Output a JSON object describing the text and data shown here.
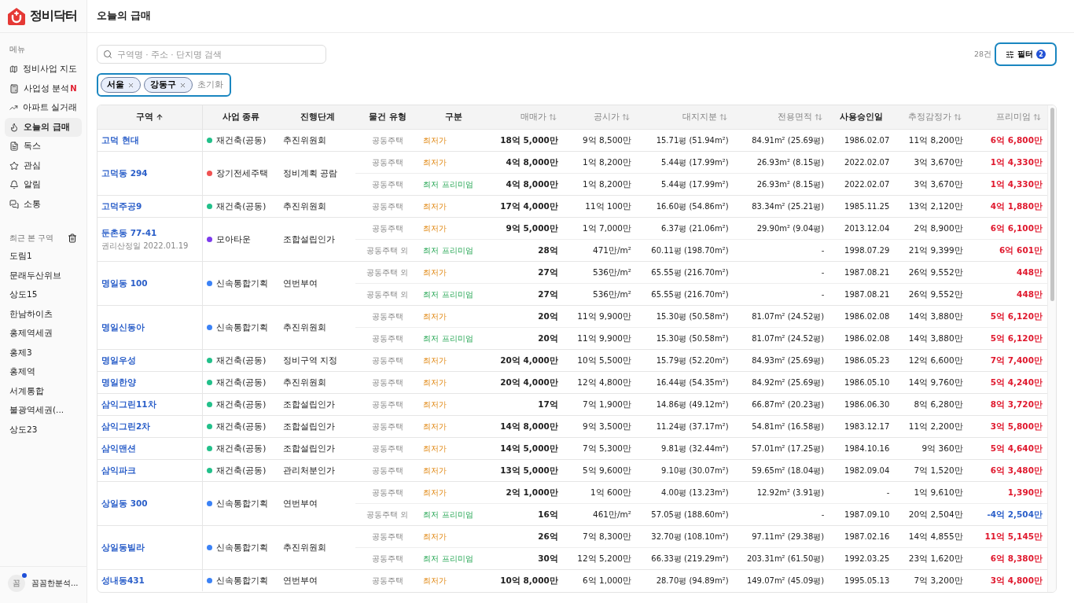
{
  "sidebar": {
    "logo": "정비닥터",
    "menu_label": "메뉴",
    "menu": [
      {
        "label": "정비사업 지도",
        "selected": false
      },
      {
        "label": "사업성 분석",
        "selected": false,
        "badge": "N"
      },
      {
        "label": "아파트 실거래",
        "selected": false
      },
      {
        "label": "오늘의 급매",
        "selected": true
      },
      {
        "label": "독스",
        "selected": false
      },
      {
        "label": "관심",
        "selected": false
      },
      {
        "label": "알림",
        "selected": false
      },
      {
        "label": "소통",
        "selected": false
      }
    ],
    "recent_label": "최근 본 구역",
    "recent": [
      "도림1",
      "문래두산위브",
      "상도15",
      "한남하이츠",
      "홍제역세권",
      "홍제3",
      "홍제역",
      "서계통합",
      "불광역세권(...",
      "상도23"
    ],
    "user": {
      "avatar": "꼼",
      "name": "꼼꼼한분석...",
      "online": true
    }
  },
  "page_title": "오늘의 급매",
  "search": {
    "placeholder": "구역명 · 주소 · 단지명 검색"
  },
  "result_count": "28건",
  "filter": {
    "label": "필터",
    "count": "2"
  },
  "chips": [
    "서울",
    "강동구"
  ],
  "reset": "초기화",
  "table": {
    "columns": [
      {
        "label": "구역",
        "sortable": true,
        "sorted": true
      },
      {
        "label": "사업 종류",
        "sortable": false,
        "sorted": false
      },
      {
        "label": "진행단계",
        "sortable": false,
        "sorted": false
      },
      {
        "label": "물건 유형",
        "sortable": false,
        "sorted": false
      },
      {
        "label": "구분",
        "sortable": false,
        "sorted": false
      },
      {
        "label": "매매가",
        "sortable": true,
        "sorted": false
      },
      {
        "label": "공시가",
        "sortable": true,
        "sorted": false
      },
      {
        "label": "대지지분",
        "sortable": true,
        "sorted": false
      },
      {
        "label": "전용면적",
        "sortable": true,
        "sorted": false
      },
      {
        "label": "사용승인일",
        "sortable": false,
        "sorted": false
      },
      {
        "label": "추정감정가",
        "sortable": true,
        "sorted": false
      },
      {
        "label": "프리미엄",
        "sortable": true,
        "sorted": false
      }
    ],
    "groups": [
      {
        "name": "고덕 현대",
        "type": {
          "label": "재건축(공동)",
          "color": "#22c08a"
        },
        "stage": "추진위원회",
        "listings": [
          {
            "property_type": "공동주택",
            "kind": "lowest",
            "category": "최저가",
            "price": "18억 5,000만",
            "official_price": "9억 8,500만",
            "land_share": "15.71평 (51.94m²)",
            "area": "84.91m² (25.69평)",
            "approval_date": "1986.02.07",
            "appraisal": "11억 8,200만",
            "premium": "6억 6,800만",
            "premium_negative": false
          }
        ]
      },
      {
        "name": "고덕동 294",
        "type": {
          "label": "장기전세주택",
          "color": "#f05252"
        },
        "stage": "정비계획 공람",
        "listings": [
          {
            "property_type": "공동주택",
            "kind": "lowest",
            "category": "최저가",
            "price": "4억 8,000만",
            "official_price": "1억 8,200만",
            "land_share": "5.44평 (17.99m²)",
            "area": "26.93m² (8.15평)",
            "approval_date": "2022.02.07",
            "appraisal": "3억 3,670만",
            "premium": "1억 4,330만",
            "premium_negative": false
          },
          {
            "property_type": "공동주택",
            "kind": "premium",
            "category": "최저 프리미엄",
            "price": "4억 8,000만",
            "official_price": "1억 8,200만",
            "land_share": "5.44평 (17.99m²)",
            "area": "26.93m² (8.15평)",
            "approval_date": "2022.02.07",
            "appraisal": "3억 3,670만",
            "premium": "1억 4,330만",
            "premium_negative": false
          }
        ]
      },
      {
        "name": "고덕주공9",
        "type": {
          "label": "재건축(공동)",
          "color": "#22c08a"
        },
        "stage": "추진위원회",
        "listings": [
          {
            "property_type": "공동주택",
            "kind": "lowest",
            "category": "최저가",
            "price": "17억 4,000만",
            "official_price": "11억 100만",
            "land_share": "16.60평 (54.86m²)",
            "area": "83.34m² (25.21평)",
            "approval_date": "1985.11.25",
            "appraisal": "13억 2,120만",
            "premium": "4억 1,880만",
            "premium_negative": false
          }
        ]
      },
      {
        "name": "둔촌동 77-41",
        "note": "권리산정일 2022.01.19",
        "type": {
          "label": "모아타운",
          "color": "#7c3aed"
        },
        "stage": "조합설립인가",
        "listings": [
          {
            "property_type": "공동주택",
            "kind": "lowest",
            "category": "최저가",
            "price": "9억 5,000만",
            "official_price": "1억 7,000만",
            "land_share": "6.37평 (21.06m²)",
            "area": "29.90m² (9.04평)",
            "approval_date": "2013.12.04",
            "appraisal": "2억 8,900만",
            "premium": "6억 6,100만",
            "premium_negative": false
          },
          {
            "property_type": "공동주택 외",
            "kind": "premium",
            "category": "최저 프리미엄",
            "price": "28억",
            "official_price": "471만/m²",
            "land_share": "60.11평 (198.70m²)",
            "area": "-",
            "approval_date": "1998.07.29",
            "appraisal": "21억 9,399만",
            "premium": "6억 601만",
            "premium_negative": false
          }
        ]
      },
      {
        "name": "명일동 100",
        "type": {
          "label": "신속통합기획",
          "color": "#3b82f6"
        },
        "stage": "연번부여",
        "listings": [
          {
            "property_type": "공동주택 외",
            "kind": "lowest",
            "category": "최저가",
            "price": "27억",
            "official_price": "536만/m²",
            "land_share": "65.55평 (216.70m²)",
            "area": "-",
            "approval_date": "1987.08.21",
            "appraisal": "26억 9,552만",
            "premium": "448만",
            "premium_negative": false
          },
          {
            "property_type": "공동주택 외",
            "kind": "premium",
            "category": "최저 프리미엄",
            "price": "27억",
            "official_price": "536만/m²",
            "land_share": "65.55평 (216.70m²)",
            "area": "-",
            "approval_date": "1987.08.21",
            "appraisal": "26억 9,552만",
            "premium": "448만",
            "premium_negative": false
          }
        ]
      },
      {
        "name": "명일신동아",
        "type": {
          "label": "신속통합기획",
          "color": "#3b82f6"
        },
        "stage": "추진위원회",
        "listings": [
          {
            "property_type": "공동주택",
            "kind": "lowest",
            "category": "최저가",
            "price": "20억",
            "official_price": "11억 9,900만",
            "land_share": "15.30평 (50.58m²)",
            "area": "81.07m² (24.52평)",
            "approval_date": "1986.02.08",
            "appraisal": "14억 3,880만",
            "premium": "5억 6,120만",
            "premium_negative": false
          },
          {
            "property_type": "공동주택",
            "kind": "premium",
            "category": "최저 프리미엄",
            "price": "20억",
            "official_price": "11억 9,900만",
            "land_share": "15.30평 (50.58m²)",
            "area": "81.07m² (24.52평)",
            "approval_date": "1986.02.08",
            "appraisal": "14억 3,880만",
            "premium": "5억 6,120만",
            "premium_negative": false
          }
        ]
      },
      {
        "name": "명일우성",
        "type": {
          "label": "재건축(공동)",
          "color": "#22c08a"
        },
        "stage": "정비구역 지정",
        "listings": [
          {
            "property_type": "공동주택",
            "kind": "lowest",
            "category": "최저가",
            "price": "20억 4,000만",
            "official_price": "10억 5,500만",
            "land_share": "15.79평 (52.20m²)",
            "area": "84.93m² (25.69평)",
            "approval_date": "1986.05.23",
            "appraisal": "12억 6,600만",
            "premium": "7억 7,400만",
            "premium_negative": false
          }
        ]
      },
      {
        "name": "명일한양",
        "type": {
          "label": "재건축(공동)",
          "color": "#22c08a"
        },
        "stage": "추진위원회",
        "listings": [
          {
            "property_type": "공동주택",
            "kind": "lowest",
            "category": "최저가",
            "price": "20억 4,000만",
            "official_price": "12억 4,800만",
            "land_share": "16.44평 (54.35m²)",
            "area": "84.92m² (25.69평)",
            "approval_date": "1986.05.10",
            "appraisal": "14억 9,760만",
            "premium": "5억 4,240만",
            "premium_negative": false
          }
        ]
      },
      {
        "name": "삼익그린11차",
        "type": {
          "label": "재건축(공동)",
          "color": "#22c08a"
        },
        "stage": "조합설립인가",
        "listings": [
          {
            "property_type": "공동주택",
            "kind": "lowest",
            "category": "최저가",
            "price": "17억",
            "official_price": "7억 1,900만",
            "land_share": "14.86평 (49.12m²)",
            "area": "66.87m² (20.23평)",
            "approval_date": "1986.06.30",
            "appraisal": "8억 6,280만",
            "premium": "8억 3,720만",
            "premium_negative": false
          }
        ]
      },
      {
        "name": "삼익그린2차",
        "type": {
          "label": "재건축(공동)",
          "color": "#22c08a"
        },
        "stage": "조합설립인가",
        "listings": [
          {
            "property_type": "공동주택",
            "kind": "lowest",
            "category": "최저가",
            "price": "14억 8,000만",
            "official_price": "9억 3,500만",
            "land_share": "11.24평 (37.17m²)",
            "area": "54.81m² (16.58평)",
            "approval_date": "1983.12.17",
            "appraisal": "11억 2,200만",
            "premium": "3억 5,800만",
            "premium_negative": false
          }
        ]
      },
      {
        "name": "삼익맨션",
        "type": {
          "label": "재건축(공동)",
          "color": "#22c08a"
        },
        "stage": "조합설립인가",
        "listings": [
          {
            "property_type": "공동주택",
            "kind": "lowest",
            "category": "최저가",
            "price": "14억 5,000만",
            "official_price": "7억 5,300만",
            "land_share": "9.81평 (32.44m²)",
            "area": "57.01m² (17.25평)",
            "approval_date": "1984.10.16",
            "appraisal": "9억 360만",
            "premium": "5억 4,640만",
            "premium_negative": false
          }
        ]
      },
      {
        "name": "삼익파크",
        "type": {
          "label": "재건축(공동)",
          "color": "#22c08a"
        },
        "stage": "관리처분인가",
        "listings": [
          {
            "property_type": "공동주택",
            "kind": "lowest",
            "category": "최저가",
            "price": "13억 5,000만",
            "official_price": "5억 9,600만",
            "land_share": "9.10평 (30.07m²)",
            "area": "59.65m² (18.04평)",
            "approval_date": "1982.09.04",
            "appraisal": "7억 1,520만",
            "premium": "6억 3,480만",
            "premium_negative": false
          }
        ]
      },
      {
        "name": "상일동 300",
        "type": {
          "label": "신속통합기획",
          "color": "#3b82f6"
        },
        "stage": "연번부여",
        "listings": [
          {
            "property_type": "공동주택",
            "kind": "lowest",
            "category": "최저가",
            "price": "2억 1,000만",
            "official_price": "1억 600만",
            "land_share": "4.00평 (13.23m²)",
            "area": "12.92m² (3.91평)",
            "approval_date": "-",
            "appraisal": "1억 9,610만",
            "premium": "1,390만",
            "premium_negative": false
          },
          {
            "property_type": "공동주택 외",
            "kind": "premium",
            "category": "최저 프리미엄",
            "price": "16억",
            "official_price": "461만/m²",
            "land_share": "57.05평 (188.60m²)",
            "area": "-",
            "approval_date": "1987.09.10",
            "appraisal": "20억 2,504만",
            "premium": "-4억 2,504만",
            "premium_negative": true
          }
        ]
      },
      {
        "name": "상일동빌라",
        "type": {
          "label": "신속통합기획",
          "color": "#3b82f6"
        },
        "stage": "추진위원회",
        "listings": [
          {
            "property_type": "공동주택",
            "kind": "lowest",
            "category": "최저가",
            "price": "26억",
            "official_price": "7억 8,300만",
            "land_share": "32.70평 (108.10m²)",
            "area": "97.11m² (29.38평)",
            "approval_date": "1987.02.16",
            "appraisal": "14억 4,855만",
            "premium": "11억 5,145만",
            "premium_negative": false
          },
          {
            "property_type": "공동주택",
            "kind": "premium",
            "category": "최저 프리미엄",
            "price": "30억",
            "official_price": "12억 5,200만",
            "land_share": "66.33평 (219.29m²)",
            "area": "203.31m² (61.50평)",
            "approval_date": "1992.03.25",
            "appraisal": "23억 1,620만",
            "premium": "6억 8,380만",
            "premium_negative": false
          }
        ]
      },
      {
        "name": "성내동431",
        "type": {
          "label": "신속통합기획",
          "color": "#3b82f6"
        },
        "stage": "연번부여",
        "listings": [
          {
            "property_type": "공동주택",
            "kind": "lowest",
            "category": "최저가",
            "price": "10억 8,000만",
            "official_price": "6억 1,000만",
            "land_share": "28.70평 (94.89m²)",
            "area": "149.07m² (45.09평)",
            "approval_date": "1995.05.13",
            "appraisal": "7억 3,200만",
            "premium": "3억 4,800만",
            "premium_negative": false
          }
        ]
      }
    ]
  }
}
